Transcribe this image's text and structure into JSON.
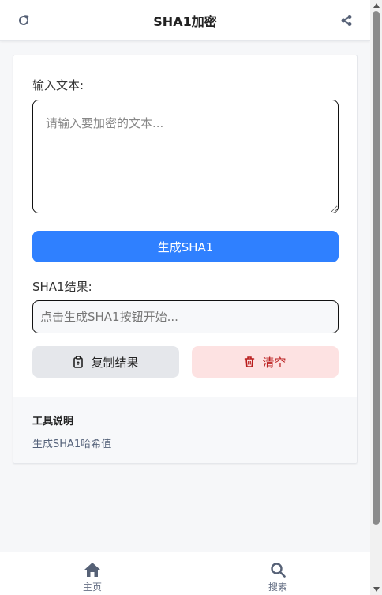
{
  "header": {
    "title": "SHA1加密",
    "refresh_icon": "refresh-icon",
    "share_icon": "share-icon"
  },
  "form": {
    "input_label": "输入文本:",
    "input_placeholder": "请输入要加密的文本...",
    "input_value": "",
    "generate_button": "生成SHA1",
    "result_label": "SHA1结果:",
    "result_placeholder": "点击生成SHA1按钮开始...",
    "result_value": "",
    "copy_button": "复制结果",
    "clear_button": "清空"
  },
  "notes": {
    "title": "工具说明",
    "description": "生成SHA1哈希值"
  },
  "nav": {
    "items": [
      {
        "label": "主页",
        "icon": "home-icon"
      },
      {
        "label": "搜索",
        "icon": "search-icon"
      }
    ]
  },
  "colors": {
    "primary": "#2f80ff",
    "danger_bg": "#fde2e2",
    "danger_text": "#b91c1c",
    "neutral_bg": "#e5e7eb"
  }
}
